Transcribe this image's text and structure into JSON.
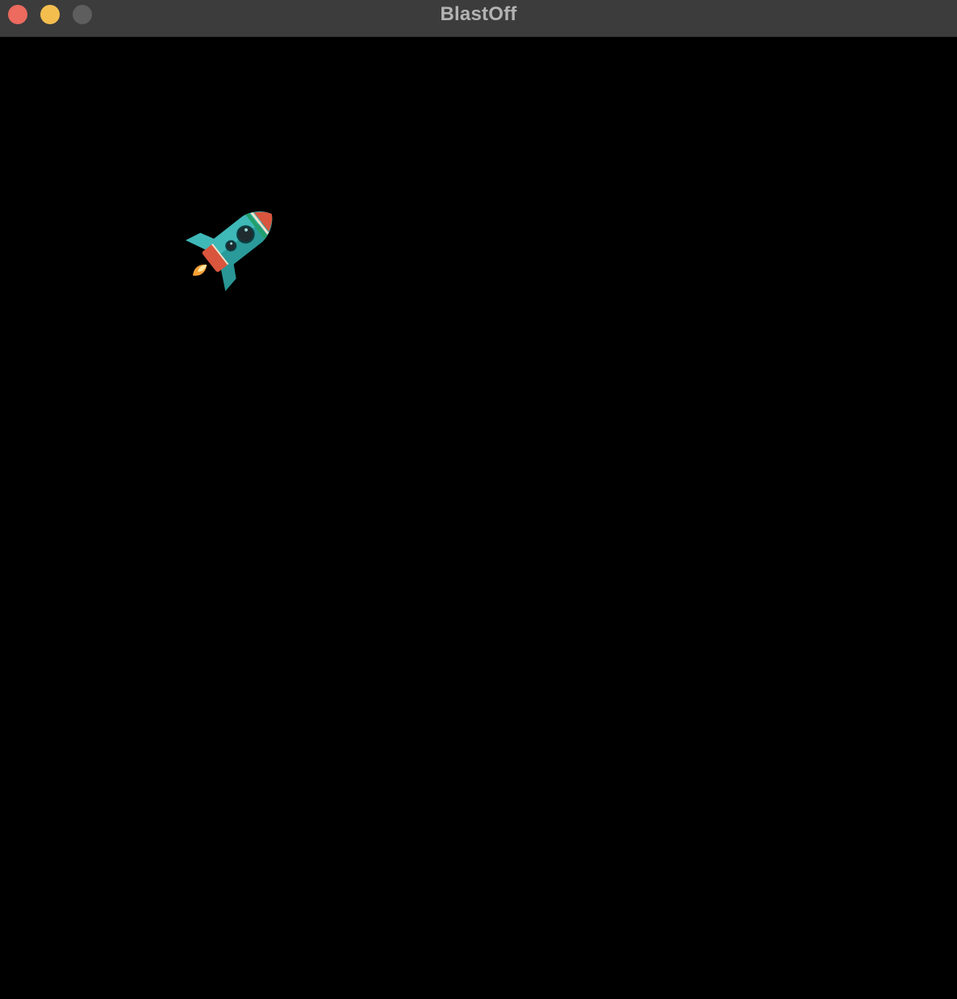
{
  "window": {
    "title": "BlastOff",
    "controls": {
      "close_color": "#ec6a5e",
      "minimize_color": "#f4be4f",
      "zoom_color": "#5e5e5e"
    }
  },
  "game": {
    "background": "#000000",
    "sprites": [
      {
        "name": "rocket",
        "icon": "rocket-icon",
        "body_color": "#3fb8b8",
        "accent_color": "#d9553d",
        "flame_color": "#f7a035"
      }
    ]
  }
}
